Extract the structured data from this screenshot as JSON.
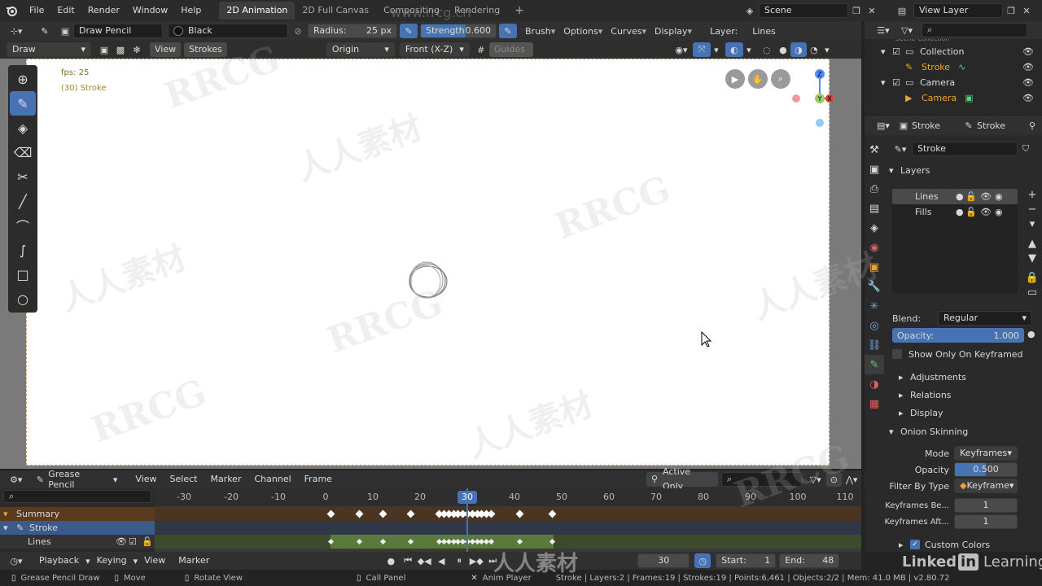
{
  "topbar": {
    "menus": [
      "File",
      "Edit",
      "Render",
      "Window",
      "Help"
    ],
    "workspaces": [
      "2D Animation",
      "2D Full Canvas",
      "Compositing",
      "Rendering"
    ],
    "add_tab": "+",
    "scene": "Scene",
    "view_layer": "View Layer"
  },
  "tool_header": {
    "brush": "Draw Pencil",
    "material": "Black",
    "radius_label": "Radius:",
    "radius_value": "25 px",
    "strength_label": "Strength",
    "strength_value": "0.600",
    "brush_menu": "Brush",
    "options": "Options",
    "curves": "Curves",
    "display": "Display",
    "layer_label": "Layer:",
    "layer_value": "Lines"
  },
  "viewport_header": {
    "mode": "Draw",
    "view": "View",
    "strokes": "Strokes",
    "origin": "Origin",
    "orientation": "Front (X-Z)",
    "guides": "Guides"
  },
  "viewport": {
    "fps": "fps: 25",
    "object_info": "(30) Stroke"
  },
  "outliner": {
    "partial": "Scene Collection",
    "collection": "Collection",
    "stroke": "Stroke",
    "camera_parent": "Camera",
    "camera": "Camera"
  },
  "properties": {
    "header_left": "Stroke",
    "header_right": "Stroke",
    "data_name": "Stroke",
    "layers_title": "Layers",
    "layers": [
      "Lines",
      "Fills"
    ],
    "blend_label": "Blend:",
    "blend_value": "Regular",
    "opacity_label": "Opacity:",
    "opacity_value": "1.000",
    "show_only_keyframed": "Show Only On Keyframed",
    "adjustments": "Adjustments",
    "relations": "Relations",
    "display": "Display",
    "onion_title": "Onion Skinning",
    "mode_label": "Mode",
    "mode_value": "Keyframes",
    "onion_opacity_label": "Opacity",
    "onion_opacity_value": "0.500",
    "filter_label": "Filter By Type",
    "filter_value": "Keyframe",
    "kf_before_label": "Keyframes Be...",
    "kf_before_value": "1",
    "kf_after_label": "Keyframes Aft...",
    "kf_after_value": "1",
    "custom_colors": "Custom Colors"
  },
  "dopesheet": {
    "mode": "Grease Pencil",
    "menus": [
      "View",
      "Select",
      "Marker",
      "Channel",
      "Frame"
    ],
    "active_only": "Active Only",
    "ruler": [
      "-30",
      "-20",
      "-10",
      "0",
      "10",
      "20",
      "30",
      "40",
      "50",
      "60",
      "70",
      "80",
      "90",
      "100",
      "110"
    ],
    "current_frame": "30",
    "channels": {
      "summary": "Summary",
      "stroke": "Stroke",
      "lines": "Lines"
    }
  },
  "playback": {
    "menus": [
      "Playback",
      "Keying",
      "View",
      "Marker"
    ],
    "frame": "30",
    "start_label": "Start:",
    "start_value": "1",
    "end_label": "End:",
    "end_value": "48"
  },
  "statusbar": {
    "items": [
      "Grease Pencil Draw",
      "Move",
      "Rotate View",
      "Call Panel",
      "Anim Player"
    ],
    "info": "Stroke | Layers:2 | Frames:19 | Strokes:19 | Points:6,461 | Objects:2/2 | Mem: 41.0 MB | v2.80.72"
  },
  "watermarks": {
    "rrcg": "RRCG",
    "cn": "人人素材",
    "url": "www.rrcg.cn",
    "linkedin": "Linked",
    "linkedin_in": "in",
    "learning": "Learning"
  },
  "colors": {
    "accent": "#4772b3",
    "summary_row": "#5a3b20",
    "stroke_row": "#3a5a8a",
    "lines_row": "#4c6b2e",
    "frame_blue": "#4772b3"
  }
}
